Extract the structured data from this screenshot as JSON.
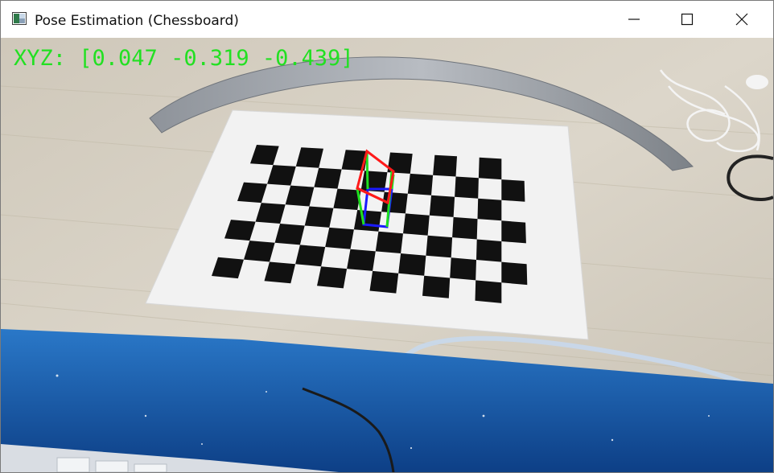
{
  "window": {
    "title": "Pose Estimation (Chessboard)",
    "app_icon": "window-app-icon",
    "controls": [
      "minimize-icon",
      "maximize-icon",
      "close-icon"
    ]
  },
  "overlay": {
    "pose_text": "XYZ: [0.047 -0.319 -0.439]",
    "text_color": "#22e022"
  },
  "axes_colors": {
    "x_axis": "#ff1a1a",
    "y_axis": "#1fe01f",
    "z_axis": "#1a1aff"
  }
}
